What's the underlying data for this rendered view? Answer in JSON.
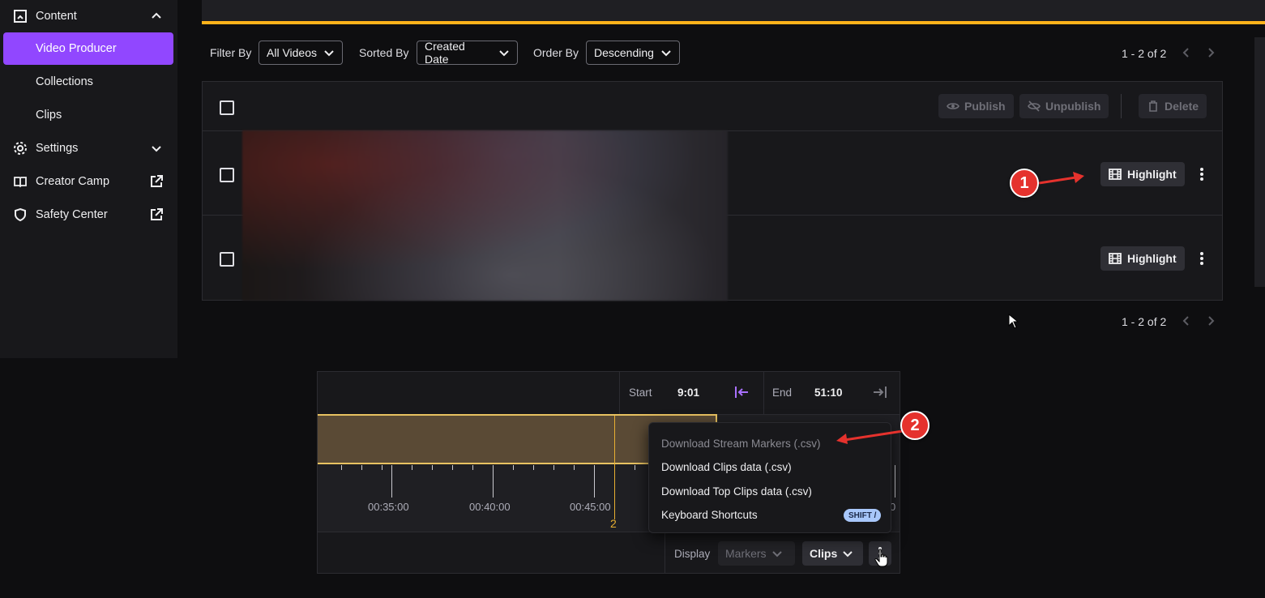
{
  "sidebar": {
    "content_label": "Content",
    "items": [
      {
        "label": "Video Producer"
      },
      {
        "label": "Collections"
      },
      {
        "label": "Clips"
      }
    ],
    "settings_label": "Settings",
    "creator_camp_label": "Creator Camp",
    "safety_center_label": "Safety Center"
  },
  "filters": {
    "filter_by_label": "Filter By",
    "filter_by_value": "All Videos",
    "sorted_by_label": "Sorted By",
    "sorted_by_value": "Created Date",
    "order_by_label": "Order By",
    "order_by_value": "Descending"
  },
  "pagination": {
    "top": "1 - 2 of 2",
    "bottom": "1 - 2 of 2"
  },
  "bulk_actions": {
    "publish": "Publish",
    "unpublish": "Unpublish",
    "delete": "Delete"
  },
  "videos": [
    {
      "type_label": "Highlight"
    },
    {
      "type_label": "Highlight"
    }
  ],
  "annotations": {
    "one": "1",
    "two": "2"
  },
  "timeline": {
    "start_label": "Start",
    "start_value": "9:01",
    "end_label": "End",
    "end_value": "51:10",
    "time_labels": [
      "00:35:00",
      "00:40:00",
      "00:45:00"
    ],
    "trailing_label_fragment": "0",
    "marker_number": "2",
    "display_label": "Display",
    "markers_label": "Markers",
    "clips_label": "Clips"
  },
  "menu": {
    "items": [
      {
        "label": "Download Stream Markers (.csv)"
      },
      {
        "label": "Download Clips data (.csv)"
      },
      {
        "label": "Download Top Clips data (.csv)"
      },
      {
        "label": "Keyboard Shortcuts"
      }
    ],
    "shortcut_badge": "SHIFT /"
  },
  "colors": {
    "accent_purple": "#9147ff",
    "accent_orange": "#ffb31a",
    "annotation_red": "#e5322d",
    "clip_fill": "#5a4a35",
    "clip_border": "#e8c261"
  }
}
